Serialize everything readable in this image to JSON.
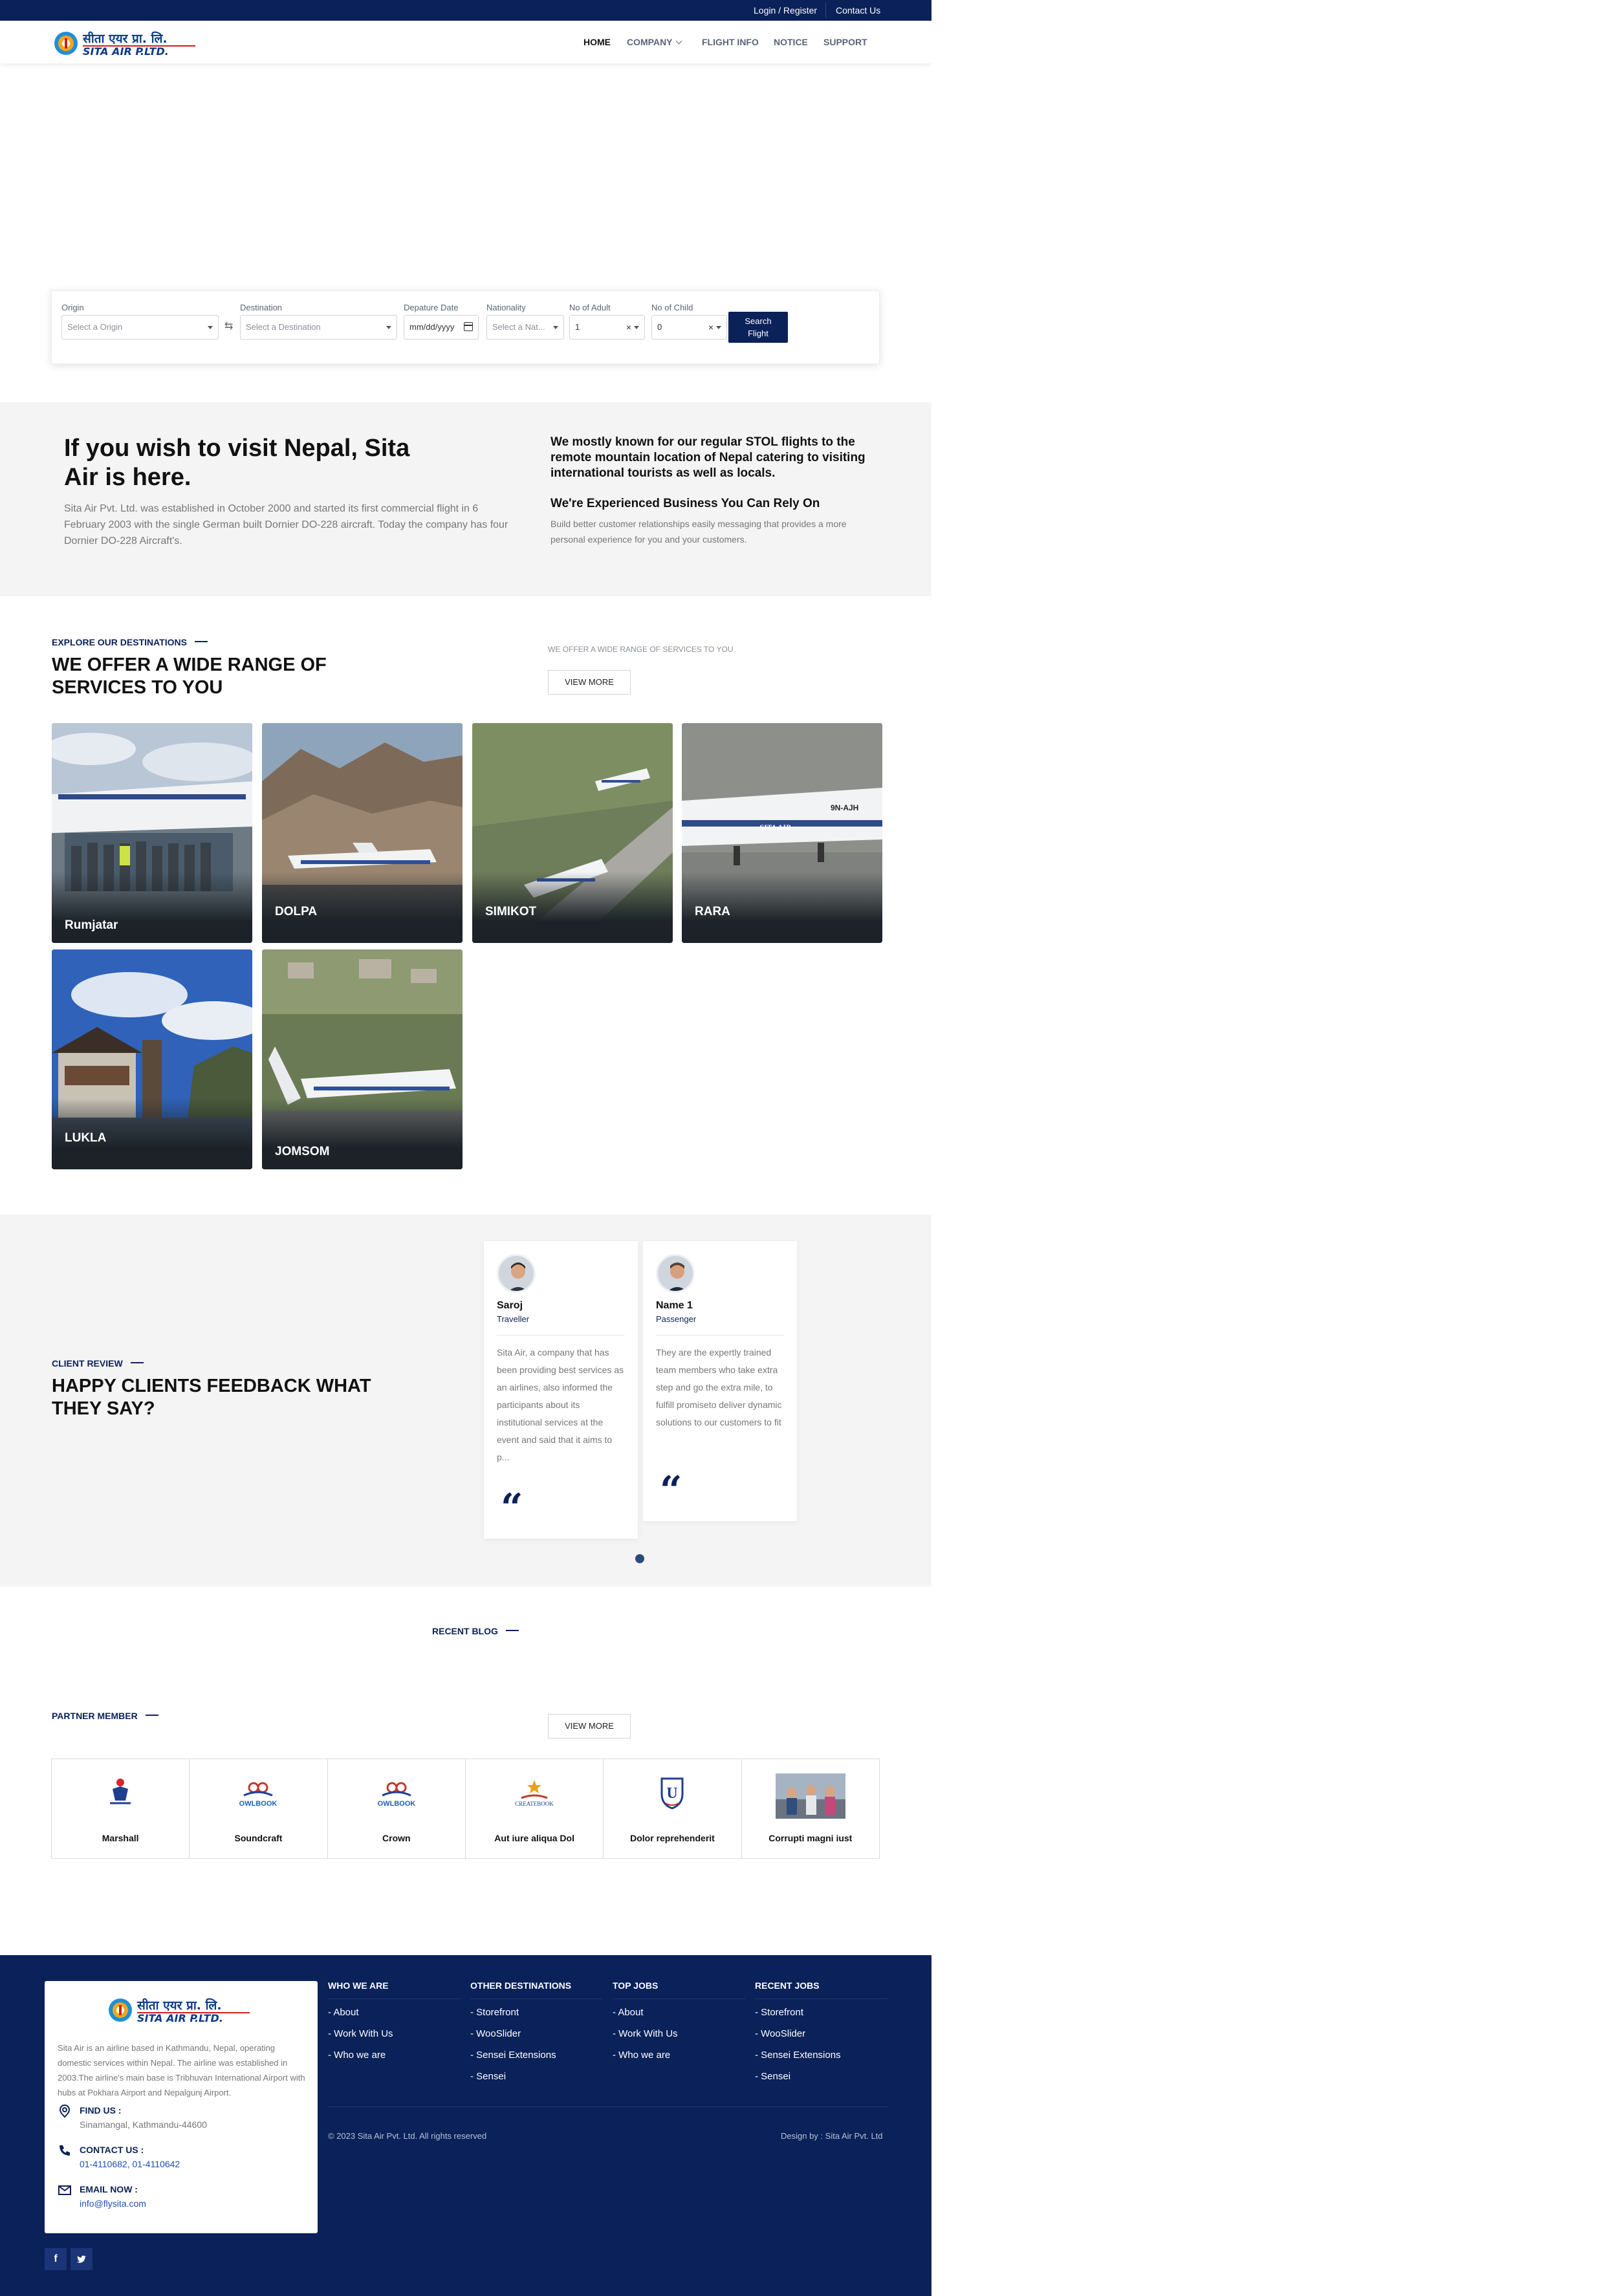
{
  "topbar": {
    "login": "Login / Register",
    "contact": "Contact Us"
  },
  "brand": {
    "logo_np": "सीता एयर प्रा. लि.",
    "logo_en": "SITA AIR P.LTD."
  },
  "nav": [
    {
      "label": "HOME",
      "active": true
    },
    {
      "label": "COMPANY",
      "dropdown": true
    },
    {
      "label": "FLIGHT INFO"
    },
    {
      "label": "NOTICE"
    },
    {
      "label": "SUPPORT"
    }
  ],
  "search": {
    "origin_label": "Origin",
    "origin_placeholder": "Select a Origin",
    "destination_label": "Destination",
    "destination_placeholder": "Select a Destination",
    "date_label": "Depature Date",
    "date_placeholder": "mm/dd/yyyy",
    "nationality_label": "Nationality",
    "nationality_placeholder": "Select a Nat...",
    "adult_label": "No of Adult",
    "adult_value": "1",
    "child_label": "No of Child",
    "child_value": "0",
    "button_line1": "Search",
    "button_line2": "Flight"
  },
  "about": {
    "heading": "If you wish to visit Nepal, Sita Air is here.",
    "paragraph": "Sita Air Pvt. Ltd. was established in October 2000 and started its first commercial flight in 6 February 2003 with the single German built Dornier DO-228 aircraft. Today the company has four Dornier DO-228 Aircraft's.",
    "right_heading": "We mostly known for our regular STOL flights to the remote mountain location of Nepal catering to visiting international tourists as well as locals.",
    "right_subheading": "We're Experienced Business You Can Rely On",
    "right_paragraph": "Build better customer relationships easily messaging that provides a more personal experience for you and your customers."
  },
  "destinations": {
    "kicker": "EXPLORE OUR DESTINATIONS",
    "heading": "WE OFFER A WIDE RANGE OF SERVICES TO YOU",
    "side_text": "WE OFFER A WIDE RANGE OF SERVICES TO YOU",
    "view_more": "VIEW MORE",
    "items": [
      {
        "name": "Rumjatar"
      },
      {
        "name": "DOLPA"
      },
      {
        "name": "SIMIKOT"
      },
      {
        "name": "RARA"
      },
      {
        "name": "LUKLA"
      },
      {
        "name": "JOMSOM"
      }
    ]
  },
  "reviews": {
    "kicker": "CLIENT REVIEW",
    "heading": "HAPPY CLIENTS FEEDBACK WHAT THEY SAY?",
    "items": [
      {
        "name": "Saroj",
        "role": "Traveller",
        "text": "Sita Air, a company that has been providing best services as an airlines, also informed the participants about its institutional services at the event and said that it aims to p..."
      },
      {
        "name": "Name 1",
        "role": "Passenger",
        "text": "They are the expertly trained team members who take extra step and go the extra mile, to fulfill promiseto deliver dynamic solutions to our customers to fit"
      }
    ]
  },
  "blog": {
    "kicker": "RECENT BLOG"
  },
  "partners": {
    "kicker": "PARTNER MEMBER",
    "view_more": "VIEW MORE",
    "items": [
      {
        "name": "Marshall",
        "logo": "person-badge-logo"
      },
      {
        "name": "Soundcraft",
        "logo": "owlbook-logo",
        "logo_text": "OWLBOOK"
      },
      {
        "name": "Crown",
        "logo": "owlbook-logo",
        "logo_text": "OWLBOOK"
      },
      {
        "name": "Aut iure aliqua Dol",
        "logo": "createbook-logo",
        "logo_text": "CREATEBOOK"
      },
      {
        "name": "Dolor reprehenderit",
        "logo": "university-shield-logo",
        "logo_text": "U"
      },
      {
        "name": "Corrupti magni iust",
        "logo": "group-photo"
      }
    ]
  },
  "footer": {
    "description": "Sita Air is an airline based in Kathmandu, Nepal, operating domestic services within Nepal. The airline was established in 2003.The airline's main base is Tribhuvan International Airport with hubs at Pokhara Airport and Nepalgunj Airport.",
    "find_label": "FIND US :",
    "find_value": "Sinamangal, Kathmandu-44600",
    "contact_label": "CONTACT US :",
    "contact_value": "01-4110682, 01-4110642",
    "email_label": "EMAIL NOW :",
    "email_value": "info@flysita.com",
    "columns": [
      {
        "title": "WHO WE ARE",
        "items": [
          "- About",
          "- Work With Us",
          "- Who we are"
        ]
      },
      {
        "title": "OTHER DESTINATIONS",
        "items": [
          "- Storefront",
          "- WooSlider",
          "- Sensei Extensions",
          "- Sensei"
        ]
      },
      {
        "title": "TOP JOBS",
        "items": [
          "- About",
          "- Work With Us",
          "- Who we are"
        ]
      },
      {
        "title": "RECENT JOBS",
        "items": [
          "- Storefront",
          "- WooSlider",
          "- Sensei Extensions",
          "- Sensei"
        ]
      }
    ],
    "copyright": "© 2023 Sita Air Pvt. Ltd. All rights reserved",
    "design_by": "Design by : Sita Air Pvt. Ltd",
    "social": [
      "facebook-icon",
      "twitter-icon"
    ]
  }
}
